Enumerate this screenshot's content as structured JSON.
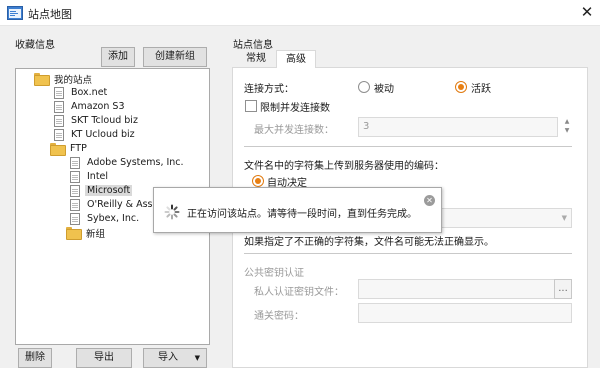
{
  "window": {
    "title": "站点地图",
    "close_icon": "close-icon"
  },
  "left": {
    "section_title": "收藏信息",
    "add_button": "添加",
    "create_button": "创建新组",
    "tree": [
      {
        "label": "我的站点",
        "icon": "folder-icon",
        "level": 0
      },
      {
        "label": "Box.net",
        "icon": "document-icon",
        "level": 1
      },
      {
        "label": "Amazon S3",
        "icon": "document-icon",
        "level": 1
      },
      {
        "label": "SKT Tcloud biz",
        "icon": "document-icon",
        "level": 1
      },
      {
        "label": "KT Ucloud biz",
        "icon": "document-icon",
        "level": 1
      },
      {
        "label": "FTP",
        "icon": "folder-icon",
        "level": 1
      },
      {
        "label": "Adobe Systems, Inc.",
        "icon": "document-icon",
        "level": 2
      },
      {
        "label": "Intel",
        "icon": "document-icon",
        "level": 2
      },
      {
        "label": "Microsoft",
        "icon": "document-icon",
        "level": 2,
        "selected": true
      },
      {
        "label": "O'Reilly & Associa",
        "icon": "document-icon",
        "level": 2
      },
      {
        "label": "Sybex, Inc.",
        "icon": "document-icon",
        "level": 2
      },
      {
        "label": "新组",
        "icon": "folder-icon",
        "level": 2
      }
    ],
    "delete_button": "删除",
    "export_button": "导出",
    "import_button": "导入"
  },
  "right": {
    "section_title": "站点信息",
    "tabs": [
      "常规",
      "高级"
    ],
    "active_tab": "高级",
    "connect_label": "连接方式：",
    "passive_label": "被动",
    "active_label": "活跃",
    "connect_mode": "活跃",
    "limit_label": "限制并发连接数",
    "limit_checked": false,
    "max_label": "最大并发连接数：",
    "max_value": "3",
    "encoding_label": "文件名中的字符集上传到服务器使用的编码：",
    "auto_label": "自动决定",
    "auto_selected": true,
    "encoding_warning": "如果指定了不正确的字符集，文件名可能无法正确显示。",
    "pubkey_section": "公共密钥认证",
    "private_key_label": "私人认证密钥文件：",
    "private_key_value": "",
    "browse_button": "...",
    "passphrase_label": "通关密码：",
    "passphrase_value": ""
  },
  "popup": {
    "message": "正在访问该站点。请等待一段时间，直到任务完成。",
    "close_icon": "close-icon",
    "spinner_icon": "spinner-icon"
  },
  "colors": {
    "accent_radio": "#e87f12",
    "folder": "#f0c24e"
  }
}
